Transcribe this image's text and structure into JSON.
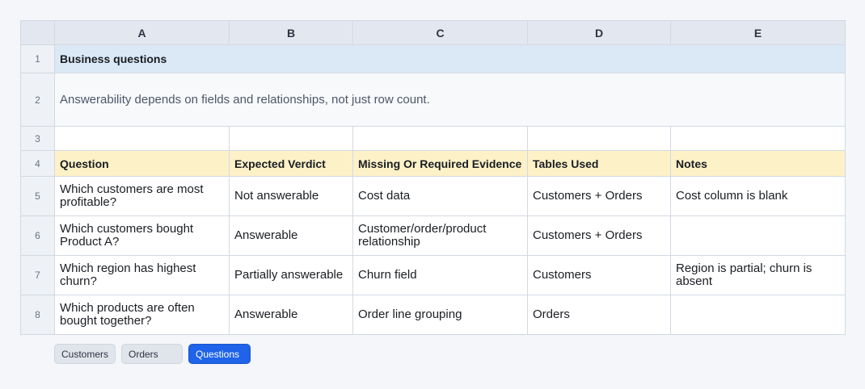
{
  "columns": [
    "A",
    "B",
    "C",
    "D",
    "E"
  ],
  "row_numbers": [
    "1",
    "2",
    "3",
    "4",
    "5",
    "6",
    "7",
    "8"
  ],
  "title": "Business questions",
  "note": "Answerability depends on fields and relationships, not just row count.",
  "header": [
    "Question",
    "Expected Verdict",
    "Missing Or Required Evidence",
    "Tables Used",
    "Notes"
  ],
  "rows": [
    [
      "Which customers are most profitable?",
      "Not answerable",
      "Cost data",
      "Customers + Orders",
      "Cost column is blank"
    ],
    [
      "Which customers bought Product A?",
      "Answerable",
      "Customer/order/product relationship",
      "Customers + Orders",
      ""
    ],
    [
      "Which region has highest churn?",
      "Partially answerable",
      "Churn field",
      "Customers",
      "Region is partial; churn is absent"
    ],
    [
      "Which products are often bought together?",
      "Answerable",
      "Order line grouping",
      "Orders",
      ""
    ]
  ],
  "tabs": [
    {
      "label": "Customers",
      "active": false
    },
    {
      "label": "Orders",
      "active": false
    },
    {
      "label": "Questions",
      "active": true
    }
  ],
  "colors": {
    "title_row": "#dbe9f6",
    "header_row": "#fdf1c8",
    "active_tab": "#1e63e9"
  }
}
